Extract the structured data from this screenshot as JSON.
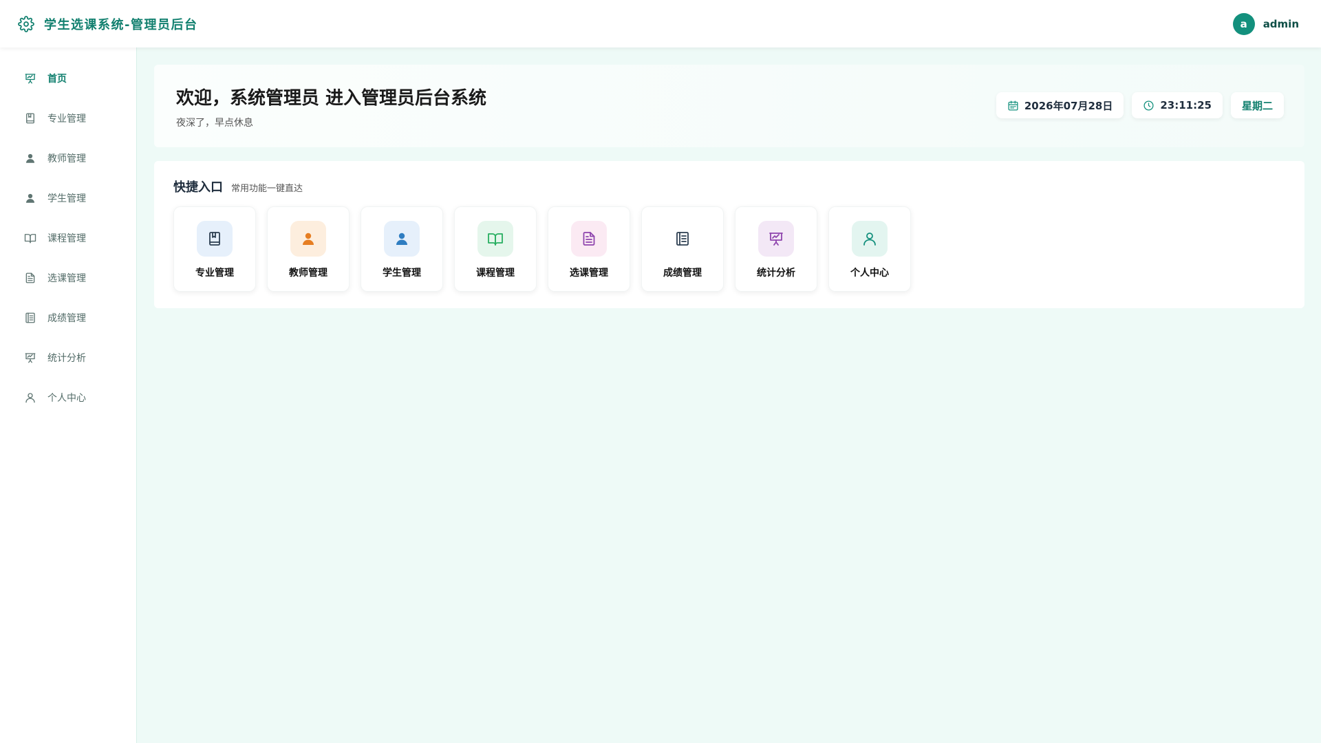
{
  "header": {
    "title": "学生选课系统-管理员后台",
    "avatar_letter": "a",
    "username": "admin"
  },
  "sidebar": {
    "items": [
      {
        "label": "首页",
        "icon": "presentation-chart-icon",
        "active": true
      },
      {
        "label": "专业管理",
        "icon": "bookmark-book-icon"
      },
      {
        "label": "教师管理",
        "icon": "user-solid-icon"
      },
      {
        "label": "学生管理",
        "icon": "user-solid-icon"
      },
      {
        "label": "课程管理",
        "icon": "open-book-icon"
      },
      {
        "label": "选课管理",
        "icon": "document-icon"
      },
      {
        "label": "成绩管理",
        "icon": "notebook-icon"
      },
      {
        "label": "统计分析",
        "icon": "presentation-chart-icon"
      },
      {
        "label": "个人中心",
        "icon": "user-outline-icon"
      }
    ]
  },
  "welcome": {
    "title": "欢迎，系统管理员 进入管理员后台系统",
    "subtitle": "夜深了，早点休息",
    "date": "2026年07月28日",
    "time": "23:11:25",
    "weekday": "星期二"
  },
  "quick": {
    "title": "快捷入口",
    "subtitle": "常用功能一键直达",
    "tiles": [
      {
        "label": "专业管理",
        "icon": "bookmark-book-icon",
        "bg": "#e6f0fb",
        "color": "#2c3e50"
      },
      {
        "label": "教师管理",
        "icon": "user-solid-icon",
        "bg": "#fdeede",
        "color": "#e67e22"
      },
      {
        "label": "学生管理",
        "icon": "user-solid-icon",
        "bg": "#e6f0fb",
        "color": "#2f7dc1"
      },
      {
        "label": "课程管理",
        "icon": "open-book-icon",
        "bg": "#e5f6ec",
        "color": "#27ae60"
      },
      {
        "label": "选课管理",
        "icon": "document-icon",
        "bg": "#fbeaf3",
        "color": "#8e44ad"
      },
      {
        "label": "成绩管理",
        "icon": "notebook-icon",
        "bg": "#ffffff",
        "color": "#2c3e50"
      },
      {
        "label": "统计分析",
        "icon": "presentation-chart-icon",
        "bg": "#f3e8f6",
        "color": "#8e44ad"
      },
      {
        "label": "个人中心",
        "icon": "user-outline-icon",
        "bg": "#e3f5f0",
        "color": "#13907d"
      }
    ]
  },
  "colors": {
    "brand": "#12806f",
    "background": "#eefaf7"
  }
}
